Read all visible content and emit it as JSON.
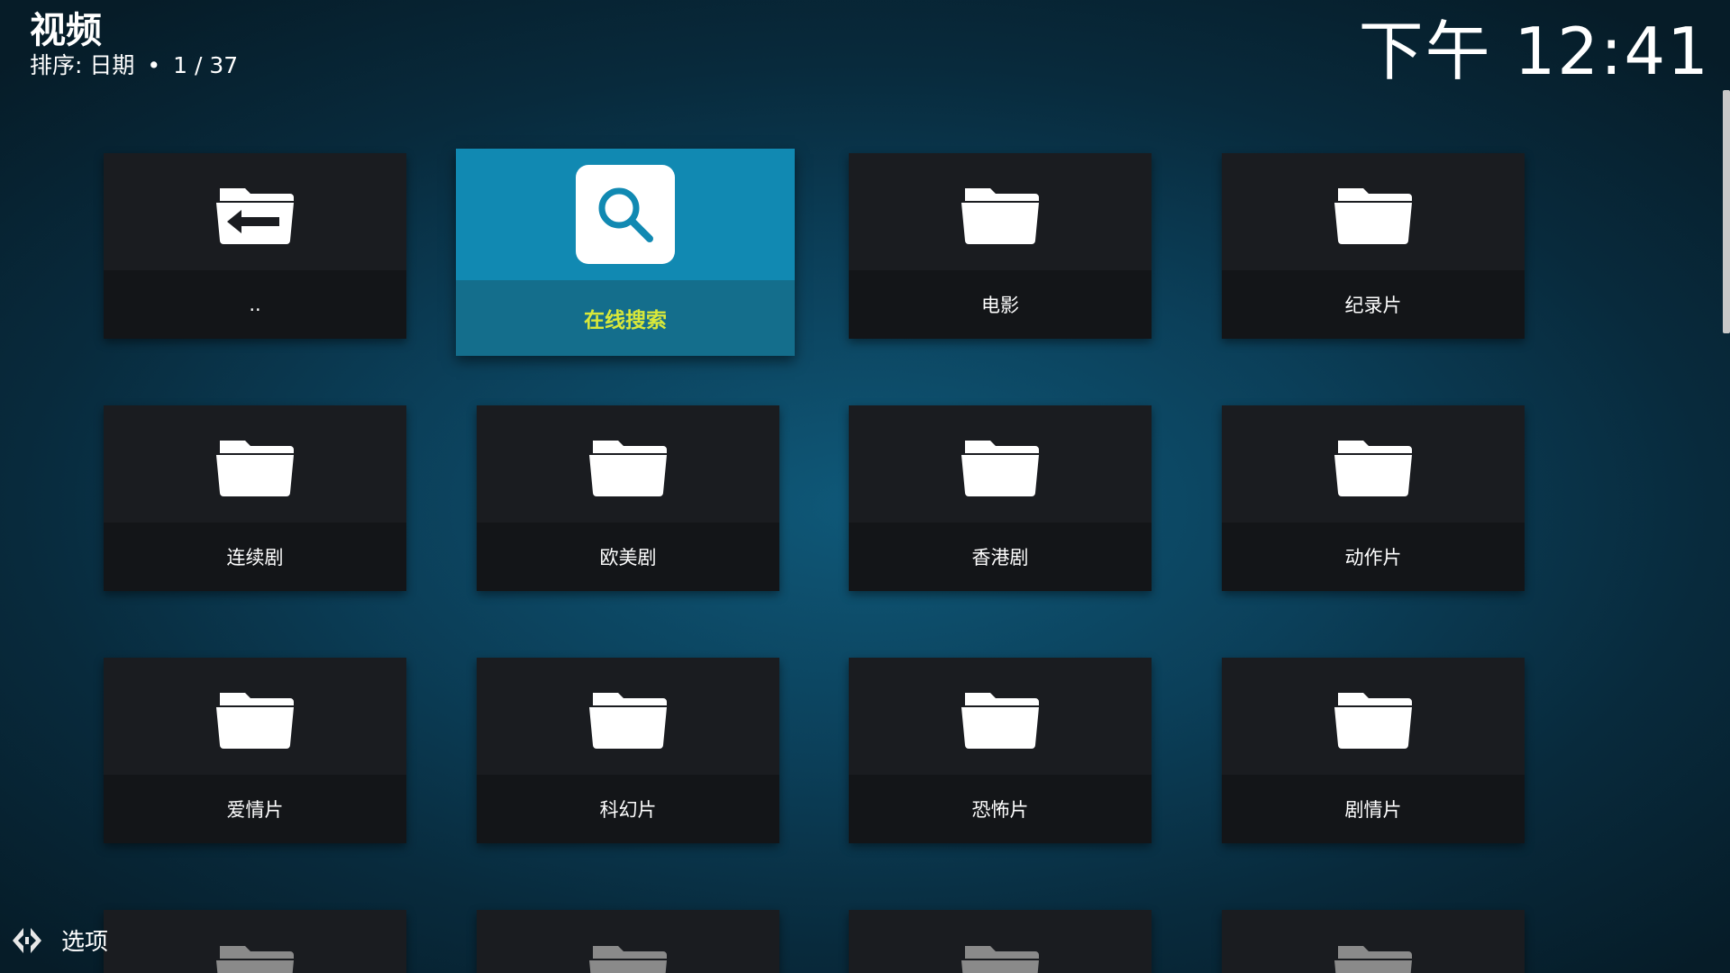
{
  "header": {
    "title": "视频",
    "sort_label": "排序: 日期",
    "separator": "•",
    "position": "1 / 37",
    "clock": "下午 12:41"
  },
  "tiles": [
    {
      "label": "..",
      "icon": "folder-back-icon"
    },
    {
      "label": "在线搜索",
      "icon": "search-icon"
    },
    {
      "label": "电影",
      "icon": "folder-icon"
    },
    {
      "label": "纪录片",
      "icon": "folder-icon"
    },
    {
      "label": "连续剧",
      "icon": "folder-icon"
    },
    {
      "label": "欧美剧",
      "icon": "folder-icon"
    },
    {
      "label": "香港剧",
      "icon": "folder-icon"
    },
    {
      "label": "动作片",
      "icon": "folder-icon"
    },
    {
      "label": "爱情片",
      "icon": "folder-icon"
    },
    {
      "label": "科幻片",
      "icon": "folder-icon"
    },
    {
      "label": "恐怖片",
      "icon": "folder-icon"
    },
    {
      "label": "剧情片",
      "icon": "folder-icon"
    }
  ],
  "footer": {
    "options_label": "选项",
    "options_icon": "options-icon"
  },
  "colors": {
    "focus_tile": "#1189b2",
    "focus_label": "#d8e83a",
    "tile_bg": "#1a1c20",
    "background": "#0b3f59"
  }
}
